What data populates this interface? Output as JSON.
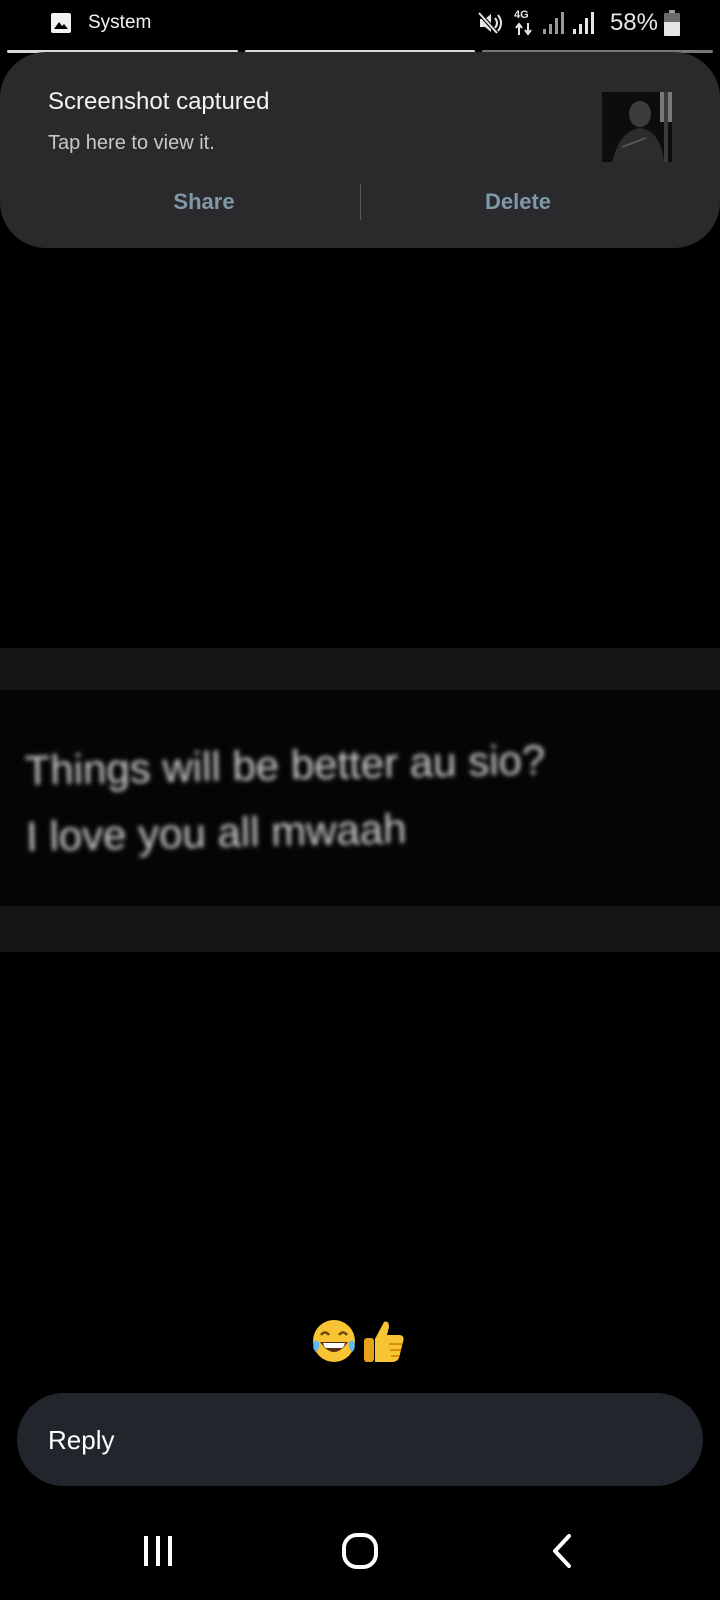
{
  "status_bar": {
    "app_name": "System",
    "network_label": "4G",
    "battery_percent": "58%",
    "icons": [
      "gallery-icon",
      "mute-icon",
      "data-4g-icon",
      "signal-icon",
      "signal-icon",
      "battery-icon"
    ]
  },
  "story": {
    "progress_segments": 3,
    "lines": [
      "Things will be better au sio?",
      "I love you all mwaah"
    ]
  },
  "notification": {
    "title": "Screenshot captured",
    "subtitle": "Tap here to view it.",
    "share_label": "Share",
    "delete_label": "Delete"
  },
  "reactions": [
    "laughing-emoji",
    "thumbs-up-emoji"
  ],
  "reply": {
    "placeholder": "Reply"
  },
  "nav": {
    "icons": [
      "recent-apps-icon",
      "home-icon",
      "back-icon"
    ]
  },
  "colors": {
    "notification_bg": "#2a2a2c",
    "action_text": "#7f98a8",
    "reply_bg": "#20262b"
  }
}
